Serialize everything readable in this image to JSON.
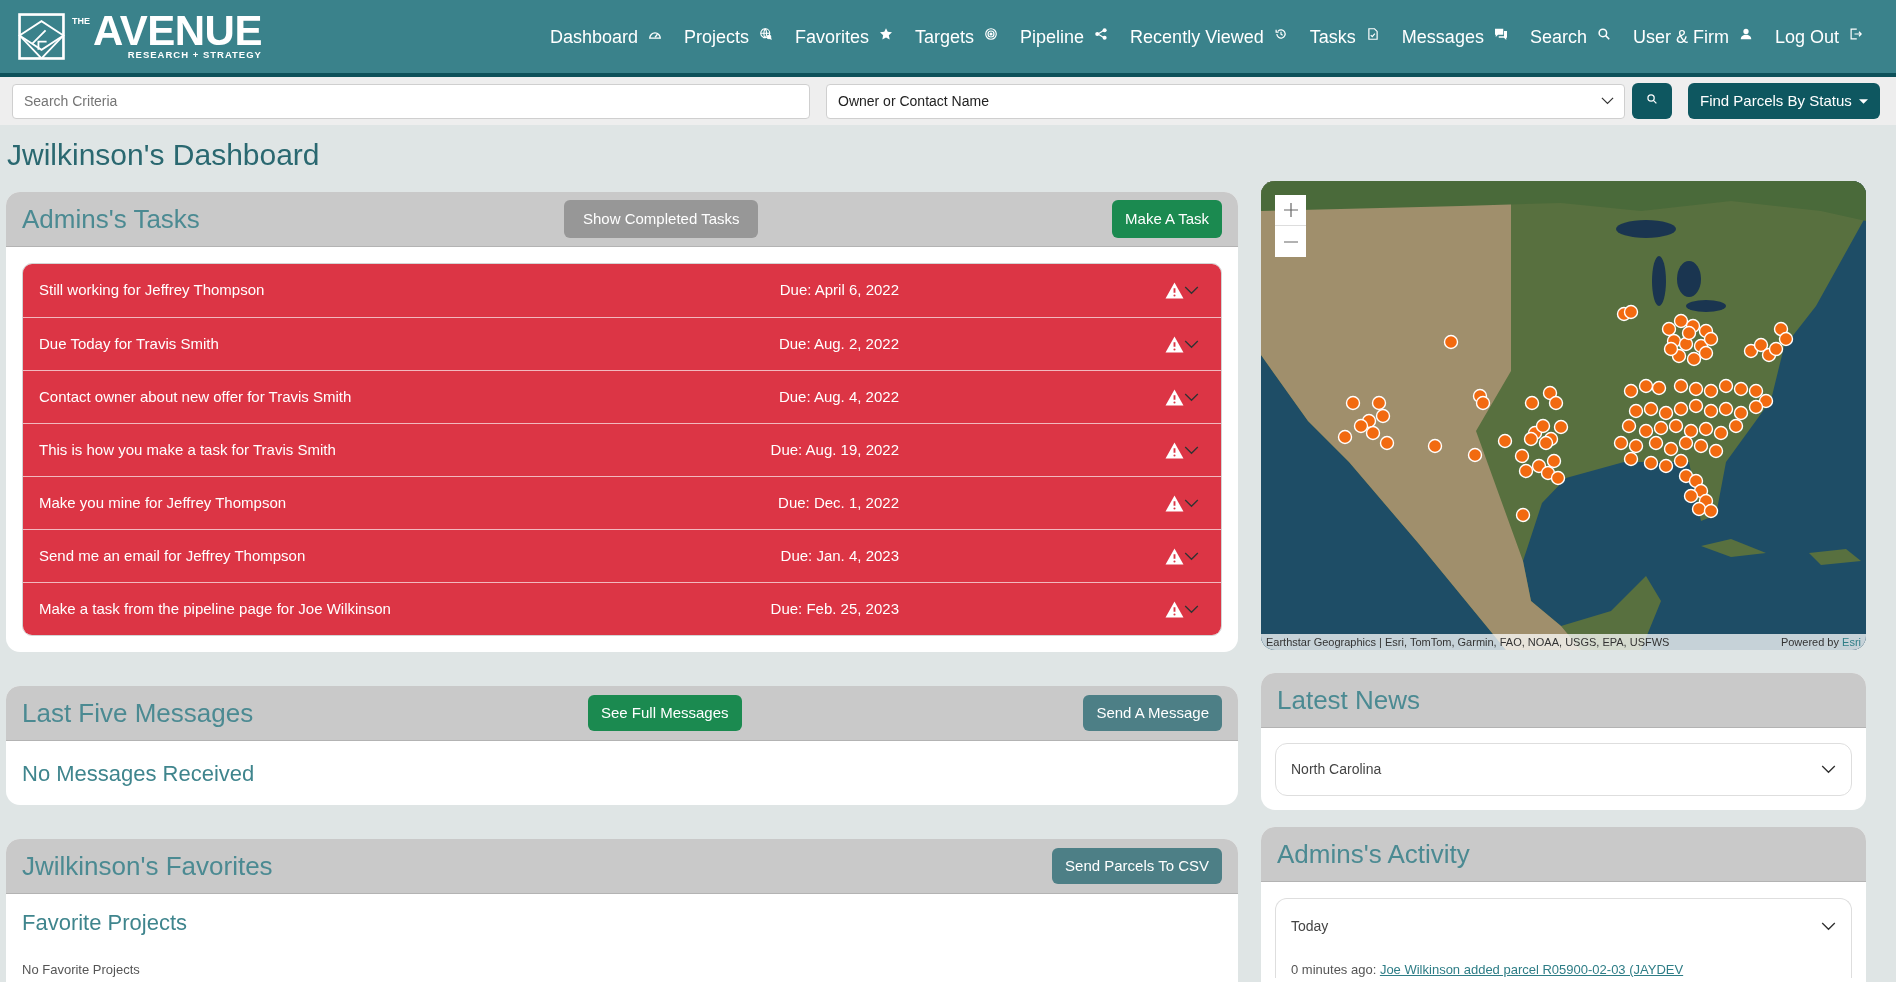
{
  "header": {
    "logo": {
      "small": "THE",
      "name": "AVENUE",
      "tagline": "RESEARCH + STRATEGY"
    },
    "nav": [
      "Dashboard",
      "Projects",
      "Favorites",
      "Targets",
      "Pipeline",
      "Recently Viewed",
      "Tasks",
      "Messages",
      "Search",
      "User & Firm",
      "Log Out"
    ]
  },
  "search_bar": {
    "criteria_field": {
      "placeholder": "Search Criteria"
    },
    "owner_select": {
      "value": "Owner or Contact Name"
    },
    "status_button": "Find Parcels By Status"
  },
  "page_title": "Jwilkinson's Dashboard",
  "tasks": {
    "title": "Admins's Tasks",
    "show_completed_button": "Show Completed Tasks",
    "make_task_button": "Make A Task",
    "items": [
      {
        "text": "Still working for Jeffrey Thompson",
        "due": "Due: April 6, 2022",
        "overdue": true
      },
      {
        "text": "Due Today for Travis Smith",
        "due": "Due: Aug. 2, 2022",
        "overdue": true
      },
      {
        "text": "Contact owner about new offer for Travis Smith",
        "due": "Due: Aug. 4, 2022",
        "overdue": true
      },
      {
        "text": "This is how you make a task for Travis Smith",
        "due": "Due: Aug. 19, 2022",
        "overdue": true
      },
      {
        "text": "Make you mine for Jeffrey Thompson",
        "due": "Due: Dec. 1, 2022",
        "overdue": true
      },
      {
        "text": "Send me an email for Jeffrey Thompson",
        "due": "Due: Jan. 4, 2023",
        "overdue": true
      },
      {
        "text": "Make a task from the pipeline page for Joe Wilkinson",
        "due": "Due: Feb. 25, 2023",
        "overdue": true
      }
    ]
  },
  "messages": {
    "title": "Last Five Messages",
    "see_full_button": "See Full Messages",
    "send_button": "Send A Message",
    "empty_text": "No Messages Received"
  },
  "favorites": {
    "title": "Jwilkinson's Favorites",
    "csv_button": "Send Parcels To CSV",
    "section_title": "Favorite Projects",
    "empty_text": "No Favorite Projects"
  },
  "map": {
    "attribution": "Earthstar Geographics | Esri, TomTom, Garmin, FAO, NOAA, USGS, EPA, USFWS",
    "powered_by": "Powered by",
    "powered_link": "Esri"
  },
  "news": {
    "title": "Latest News",
    "items": [
      {
        "label": "North Carolina"
      }
    ]
  },
  "activity": {
    "title": "Admins's Activity",
    "groups": [
      {
        "label": "Today",
        "entries": [
          {
            "time": "0 minutes ago:",
            "text": "Joe Wilkinson added parcel R05900-02-03 (JAYDEV"
          }
        ]
      }
    ]
  }
}
